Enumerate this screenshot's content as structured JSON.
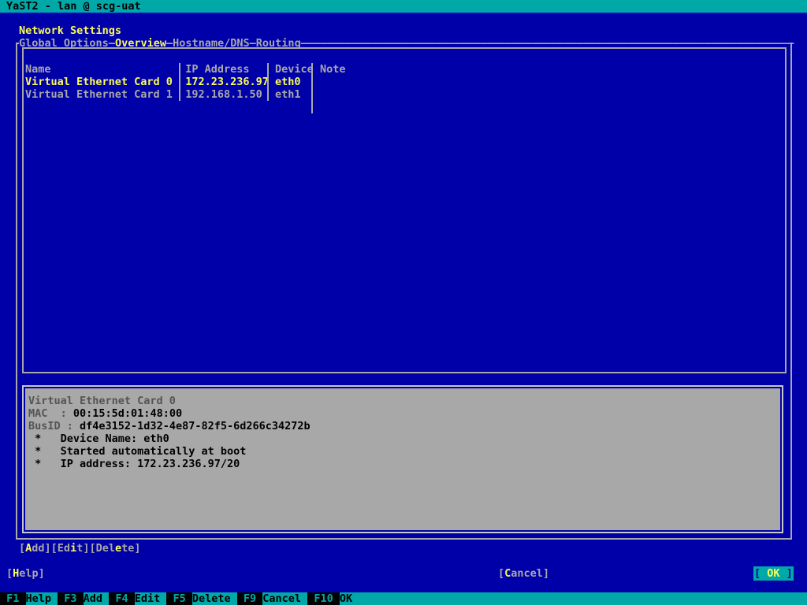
{
  "window": {
    "title": "YaST2 - lan @ scg-uat",
    "title_bg": "#00a8a8",
    "title_fg": "#000000"
  },
  "page": {
    "heading": "Network Settings"
  },
  "tabs": [
    {
      "label": "Global Options",
      "active": false
    },
    {
      "label": "Overview",
      "active": true
    },
    {
      "label": "Hostname/DNS",
      "active": false
    },
    {
      "label": "Routing",
      "active": false
    }
  ],
  "tab_separator": "—",
  "tab_trailing": "———————————————————————————————————————————————————————————————————————————",
  "table": {
    "columns": [
      {
        "key": "name",
        "header": "Name"
      },
      {
        "key": "ip",
        "header": "IP Address"
      },
      {
        "key": "device",
        "header": "Device"
      },
      {
        "key": "note",
        "header": "Note"
      }
    ],
    "header_line": "Name                   IP Address  Device Note",
    "rows": [
      {
        "selected": true,
        "text": "Virtual Ethernet Card 0 172.23.236.97 eth0",
        "name": "Virtual Ethernet Card 0",
        "ip": "172.23.236.97",
        "device": "eth0",
        "note": ""
      },
      {
        "selected": false,
        "text": "Virtual Ethernet Card 1 192.168.1.50  eth1",
        "name": "Virtual Ethernet Card 1",
        "ip": "192.168.1.50",
        "device": "eth1",
        "note": ""
      }
    ]
  },
  "detail": {
    "title": "Virtual Ethernet Card 0",
    "fields": [
      {
        "label": "MAC  : ",
        "value": "00:15:5d:01:48:00"
      },
      {
        "label": "BusID : ",
        "value": "df4e3152-1d32-4e87-82f5-6d266c34272b"
      }
    ],
    "bullets": [
      " *   Device Name: eth0",
      " *   Started automatically at boot",
      " *   IP address: 172.23.236.97/20"
    ]
  },
  "action_buttons": [
    {
      "label": "Add",
      "mnemonic_index": 0
    },
    {
      "label": "Edit",
      "mnemonic_index": 2
    },
    {
      "label": "Delete",
      "mnemonic_index": 3
    }
  ],
  "footer": {
    "help": {
      "label": "Help",
      "mnemonic_index": 0
    },
    "cancel": {
      "label": "Cancel",
      "mnemonic_index": 0
    },
    "ok": {
      "label": "OK",
      "focused": true
    }
  },
  "fkeys": [
    {
      "key": "F1",
      "label": "Help"
    },
    {
      "key": "F3",
      "label": "Add"
    },
    {
      "key": "F4",
      "label": "Edit"
    },
    {
      "key": "F5",
      "label": "Delete"
    },
    {
      "key": "F9",
      "label": "Cancel"
    },
    {
      "key": "F10",
      "label": "OK"
    }
  ],
  "colors": {
    "background": "#0000a8",
    "accent_cyan": "#00a8a8",
    "selected_yellow": "#fcfc54",
    "normal_gray": "#a8a8a8",
    "panel_gray": "#a8a8a8",
    "black": "#000000"
  }
}
